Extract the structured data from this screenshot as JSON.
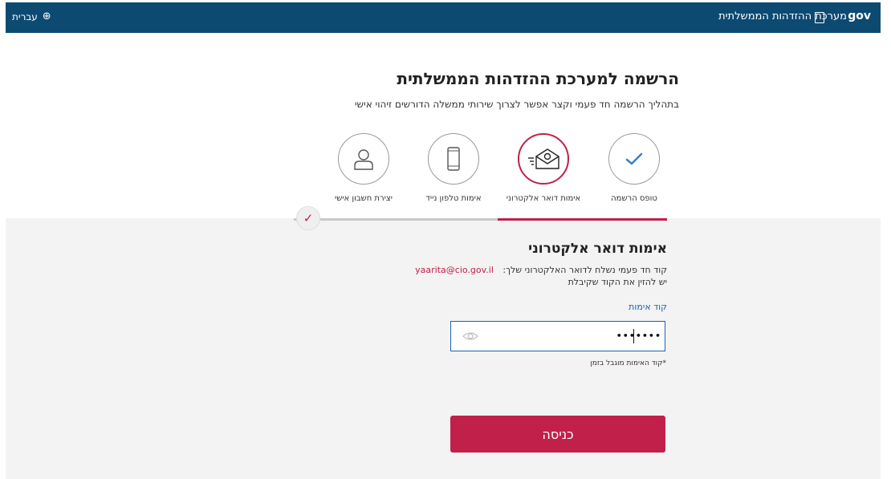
{
  "topbar": {
    "brand": "מערכת ההזדהות הממשלתית",
    "gov": "gov",
    "language": "עברית",
    "icons": [
      "globe-icon",
      "seal-icon"
    ]
  },
  "page": {
    "title": "הרשמה למערכת ההזדהות הממשלתית",
    "subtitle": "בתהליך הרשמה חד פעמי וקצר אפשר לצרוך שירותי ממשלה הדורשים זיהוי אישי"
  },
  "steps": [
    {
      "label": "טופס הרשמה",
      "icon": "checkmark-icon",
      "state": "done"
    },
    {
      "label": "אימות דואר אלקטרוני",
      "icon": "email-icon",
      "state": "active"
    },
    {
      "label": "אימות טלפון נייד",
      "icon": "mobile-phone-icon",
      "state": "pending"
    },
    {
      "label": "יצירת חשבון אישי",
      "icon": "user-icon",
      "state": "pending"
    }
  ],
  "form": {
    "heading": "אימות דואר אלקטרוני",
    "sent_text": "קוד חד פעמי נשלח לדואר האלקטרוני שלך:",
    "email": "yaarita@cio.gov.il",
    "instruction": "יש להזין את הקוד שקיבלת",
    "field_label": "קוד אימות",
    "field_value": "•••••••",
    "hint": "*קוד האימות מוגבל בזמן",
    "submit_label": "כניסה"
  },
  "colors": {
    "topbar": "#0c4a72",
    "accent": "#c1204b",
    "link": "#1a64b4",
    "panel": "#f3f3f3"
  }
}
